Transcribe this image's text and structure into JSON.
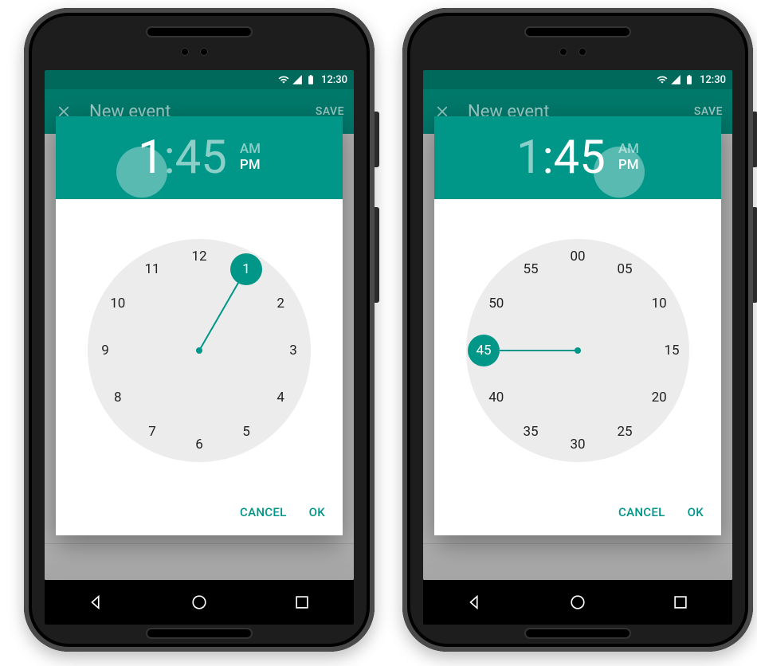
{
  "status": {
    "time": "12:30"
  },
  "appbar": {
    "title": "New event",
    "save_label": "SAVE"
  },
  "dialog": {
    "cancel_label": "CANCEL",
    "ok_label": "OK",
    "am_label": "AM",
    "pm_label": "PM"
  },
  "left": {
    "mode": "hour",
    "hour": "1",
    "minute": "45",
    "ampm_selected": "PM",
    "hours": [
      "12",
      "1",
      "2",
      "3",
      "4",
      "5",
      "6",
      "7",
      "8",
      "9",
      "10",
      "11"
    ],
    "selected_index": 1
  },
  "right": {
    "mode": "minute",
    "hour": "1",
    "minute": "45",
    "ampm_selected": "PM",
    "minutes": [
      "00",
      "05",
      "10",
      "15",
      "20",
      "25",
      "30",
      "35",
      "40",
      "45",
      "50",
      "55"
    ],
    "selected_index": 9
  }
}
